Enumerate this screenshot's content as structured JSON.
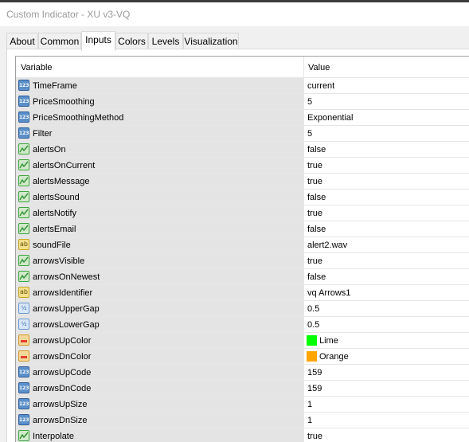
{
  "window": {
    "title": "Custom Indicator - XU v3-VQ"
  },
  "tabs": [
    {
      "label": "About",
      "active": false
    },
    {
      "label": "Common",
      "active": false
    },
    {
      "label": "Inputs",
      "active": true
    },
    {
      "label": "Colors",
      "active": false
    },
    {
      "label": "Levels",
      "active": false
    },
    {
      "label": "Visualization",
      "active": false
    }
  ],
  "table": {
    "headers": {
      "variable": "Variable",
      "value": "Value"
    },
    "rows": [
      {
        "variable": "TimeFrame",
        "value": "current",
        "type": "int"
      },
      {
        "variable": "PriceSmoothing",
        "value": "5",
        "type": "int"
      },
      {
        "variable": "PriceSmoothingMethod",
        "value": "Exponential",
        "type": "int"
      },
      {
        "variable": "Filter",
        "value": "5",
        "type": "int"
      },
      {
        "variable": "alertsOn",
        "value": "false",
        "type": "bool"
      },
      {
        "variable": "alertsOnCurrent",
        "value": "true",
        "type": "bool"
      },
      {
        "variable": "alertsMessage",
        "value": "true",
        "type": "bool"
      },
      {
        "variable": "alertsSound",
        "value": "false",
        "type": "bool"
      },
      {
        "variable": "alertsNotify",
        "value": "true",
        "type": "bool"
      },
      {
        "variable": "alertsEmail",
        "value": "false",
        "type": "bool"
      },
      {
        "variable": "soundFile",
        "value": "alert2.wav",
        "type": "string"
      },
      {
        "variable": "arrowsVisible",
        "value": "true",
        "type": "bool"
      },
      {
        "variable": "arrowsOnNewest",
        "value": "false",
        "type": "bool"
      },
      {
        "variable": "arrowsIdentifier",
        "value": "vq Arrows1",
        "type": "string"
      },
      {
        "variable": "arrowsUpperGap",
        "value": "0.5",
        "type": "double"
      },
      {
        "variable": "arrowsLowerGap",
        "value": "0.5",
        "type": "double"
      },
      {
        "variable": "arrowsUpColor",
        "value": "Lime",
        "type": "color",
        "color": "#00ff00"
      },
      {
        "variable": "arrowsDnColor",
        "value": "Orange",
        "type": "color",
        "color": "#ffa500"
      },
      {
        "variable": "arrowsUpCode",
        "value": "159",
        "type": "int"
      },
      {
        "variable": "arrowsDnCode",
        "value": "159",
        "type": "int"
      },
      {
        "variable": "arrowsUpSize",
        "value": "1",
        "type": "int"
      },
      {
        "variable": "arrowsDnSize",
        "value": "1",
        "type": "int"
      },
      {
        "variable": "Interpolate",
        "value": "true",
        "type": "bool"
      }
    ]
  },
  "icons": {
    "int": {
      "name": "integer-type-icon",
      "glyph": "123"
    },
    "bool": {
      "name": "boolean-type-icon",
      "glyph": ""
    },
    "string": {
      "name": "string-type-icon",
      "glyph": "ab"
    },
    "double": {
      "name": "double-type-icon",
      "glyph": "½"
    },
    "color": {
      "name": "color-type-icon",
      "glyph": ""
    }
  }
}
